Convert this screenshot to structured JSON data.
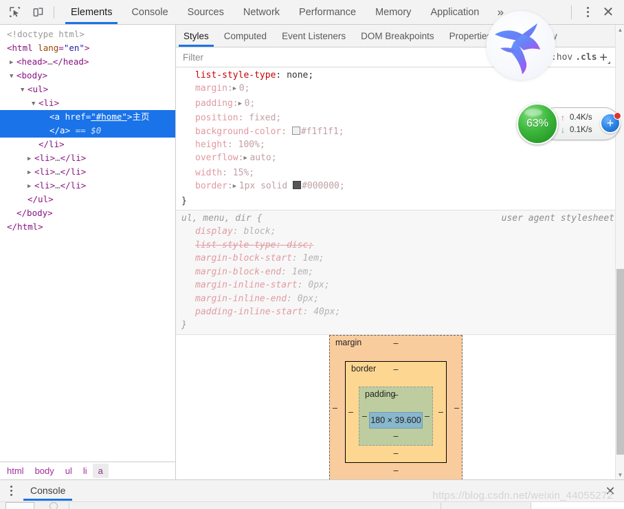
{
  "toolbar": {
    "inspect_icon": "inspect-element-icon",
    "device_icon": "device-toolbar-icon",
    "tabs": [
      {
        "label": "Elements",
        "active": true
      },
      {
        "label": "Console",
        "active": false
      },
      {
        "label": "Sources",
        "active": false
      },
      {
        "label": "Network",
        "active": false
      },
      {
        "label": "Performance",
        "active": false
      },
      {
        "label": "Memory",
        "active": false
      },
      {
        "label": "Application",
        "active": false
      }
    ],
    "overflow_label": "»",
    "close_label": "✕"
  },
  "dom_tree": {
    "rows": [
      {
        "type": "doctype",
        "text": "<!doctype html>"
      },
      {
        "type": "open_html",
        "tag": "html",
        "attr": "lang",
        "value": "\"en\""
      },
      {
        "type": "collapsed",
        "tag": "head",
        "tri": "▶"
      },
      {
        "type": "open",
        "tag": "body",
        "tri": "▼"
      },
      {
        "type": "open",
        "tag": "ul",
        "tri": "▼"
      },
      {
        "type": "open",
        "tag": "li",
        "tri": "▼"
      },
      {
        "type": "selected_a",
        "tag": "a",
        "attr": "href",
        "value": "\"#home\"",
        "text": "主页"
      },
      {
        "type": "selected_close",
        "tag": "/a",
        "marker": "== $0"
      },
      {
        "type": "close",
        "tag": "/li"
      },
      {
        "type": "collapsed",
        "tag": "li",
        "tri": "▶"
      },
      {
        "type": "collapsed",
        "tag": "li",
        "tri": "▶"
      },
      {
        "type": "collapsed",
        "tag": "li",
        "tri": "▶"
      },
      {
        "type": "close",
        "tag": "/ul"
      },
      {
        "type": "close",
        "tag": "/body"
      },
      {
        "type": "close",
        "tag": "/html"
      }
    ],
    "ellipsis": "…"
  },
  "breadcrumb": {
    "items": [
      {
        "label": "html",
        "active": false
      },
      {
        "label": "body",
        "active": false
      },
      {
        "label": "ul",
        "active": false
      },
      {
        "label": "li",
        "active": false
      },
      {
        "label": "a",
        "active": true
      }
    ]
  },
  "styles": {
    "tabs": [
      {
        "label": "Styles",
        "active": true
      },
      {
        "label": "Computed",
        "active": false
      },
      {
        "label": "Event Listeners",
        "active": false
      },
      {
        "label": "DOM Breakpoints",
        "active": false
      },
      {
        "label": "Properties",
        "active": false
      },
      {
        "label": "Accessibility",
        "active": false
      }
    ],
    "filter_placeholder": "Filter",
    "filter_value": "",
    "hov_label": ":hov",
    "cls_label": ".cls",
    "plus_label": "+",
    "rules": [
      {
        "selector": "",
        "origin": "",
        "ua": false,
        "declarations": [
          {
            "prop": "list-style-type",
            "value": "none",
            "expander": false,
            "strike": false,
            "swatch": null,
            "highlight": true
          },
          {
            "prop": "margin",
            "value": "0",
            "expander": true,
            "strike": false,
            "swatch": null
          },
          {
            "prop": "padding",
            "value": "0",
            "expander": true,
            "strike": false,
            "swatch": null
          },
          {
            "prop": "position",
            "value": "fixed",
            "expander": false,
            "strike": false,
            "swatch": null
          },
          {
            "prop": "background-color",
            "value": "#f1f1f1",
            "expander": false,
            "strike": false,
            "swatch": "#f1f1f1"
          },
          {
            "prop": "height",
            "value": "100%",
            "expander": false,
            "strike": false,
            "swatch": null
          },
          {
            "prop": "overflow",
            "value": "auto",
            "expander": true,
            "strike": false,
            "swatch": null
          },
          {
            "prop": "width",
            "value": "15%",
            "expander": false,
            "strike": false,
            "swatch": null
          },
          {
            "prop": "border",
            "value": "1px solid #000000",
            "expander": true,
            "strike": false,
            "swatch": "#000000"
          }
        ]
      },
      {
        "selector": "ul, menu, dir {",
        "origin": "user agent stylesheet",
        "ua": true,
        "declarations": [
          {
            "prop": "display",
            "value": "block",
            "expander": false,
            "strike": false,
            "swatch": null
          },
          {
            "prop": "list-style-type",
            "value": "disc",
            "expander": false,
            "strike": true,
            "swatch": null
          },
          {
            "prop": "margin-block-start",
            "value": "1em",
            "expander": false,
            "strike": false,
            "swatch": null
          },
          {
            "prop": "margin-block-end",
            "value": "1em",
            "expander": false,
            "strike": false,
            "swatch": null
          },
          {
            "prop": "margin-inline-start",
            "value": "0px",
            "expander": false,
            "strike": false,
            "swatch": null
          },
          {
            "prop": "margin-inline-end",
            "value": "0px",
            "expander": false,
            "strike": false,
            "swatch": null
          },
          {
            "prop": "padding-inline-start",
            "value": "40px",
            "expander": false,
            "strike": false,
            "swatch": null
          }
        ]
      }
    ]
  },
  "box_model": {
    "margin_label": "margin",
    "border_label": "border",
    "padding_label": "padding",
    "content_size": "180 × 39.600",
    "dash": "–",
    "margin_top": "–",
    "margin_right": "–",
    "margin_bottom": "–",
    "margin_left": "–",
    "border_top": "–",
    "border_right": "–",
    "border_bottom": "–",
    "border_left": "–",
    "padding_top": "–",
    "padding_right": "–",
    "padding_bottom": "–",
    "padding_left": "–"
  },
  "drawer": {
    "tabs": [
      {
        "label": "Console",
        "active": true
      }
    ],
    "close_label": "✕"
  },
  "watermark": {
    "text": "https://blog.csdn.net/weixin_44055272"
  },
  "speed_widget": {
    "percent": "63%",
    "upload": "0.4K/s",
    "download": "0.1K/s",
    "up_arrow": "↑",
    "down_arrow": "↓",
    "plus_label": "+"
  },
  "bird_widget": {
    "name": "hummingbird-logo"
  },
  "colors": {
    "accent_blue": "#1a73e8",
    "selection_blue": "#1a73e8",
    "tag_purple": "#881280",
    "attr_orange": "#994500",
    "value_blue": "#1a1aa6",
    "prop_red": "#c80000",
    "ua_gray": "#9a9a9a",
    "box_margin": "#f9cc9d",
    "box_border": "#fdd791",
    "box_padding": "#bdcd9f",
    "box_content": "#89b7cd",
    "speed_green": "#3cb83c",
    "badge_blue": "#2a7fe0",
    "badge_red": "#e03131"
  }
}
